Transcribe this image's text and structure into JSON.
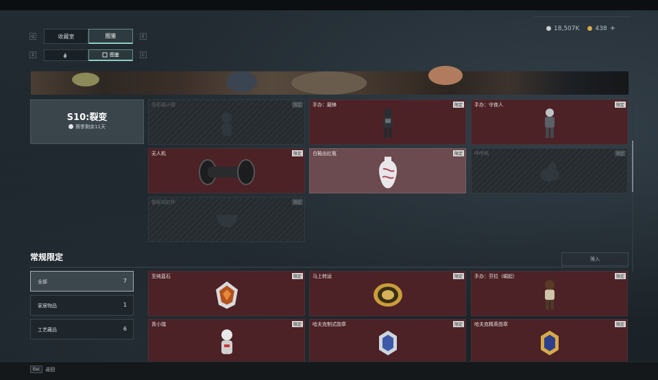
{
  "topbar": {
    "title": ""
  },
  "currency": {
    "silver_value": "18,507K",
    "gold_value": "438",
    "add_label": "+"
  },
  "tabs_primary": [
    {
      "label": "收藏室",
      "key": "Q",
      "active": false
    },
    {
      "label": "图鉴",
      "key": "E",
      "active": true
    }
  ],
  "tabs_secondary": [
    {
      "label": "",
      "key": "Z",
      "active": false
    },
    {
      "label": "图鉴",
      "key": "C",
      "active": true
    }
  ],
  "season": {
    "title": "S10:裂变",
    "subtitle": "赛季剩余11天"
  },
  "season_cards": [
    {
      "name": "炫彩福小德",
      "tag": "限定",
      "style": "dark"
    },
    {
      "name": "手办：磨锋",
      "tag": "限定",
      "style": "red"
    },
    {
      "name": "手办：守夜人",
      "tag": "限定",
      "style": "red"
    },
    {
      "name": "无人机",
      "tag": "限定",
      "style": "red"
    },
    {
      "name": "白釉出红瓶",
      "tag": "限定",
      "style": "light"
    },
    {
      "name": "呼呼鸭",
      "tag": "限定",
      "style": "dark"
    },
    {
      "name": "御窑鸡缸杯",
      "tag": "限定",
      "style": "dark"
    }
  ],
  "regular_section": {
    "title": "常规限定",
    "sort_label": "筛入"
  },
  "filters": [
    {
      "label": "全部",
      "count": "7",
      "active": true
    },
    {
      "label": "家居物品",
      "count": "1",
      "active": false
    },
    {
      "label": "工艺藏品",
      "count": "6",
      "active": false
    }
  ],
  "regular_cards": [
    {
      "name": "至纯蓝石",
      "tag": "限定"
    },
    {
      "name": "马上转运",
      "tag": "限定"
    },
    {
      "name": "手办：芬拉（崛起）",
      "tag": "限定"
    },
    {
      "name": "青小瑞",
      "tag": "限定"
    },
    {
      "name": "哈夫克制式勋章",
      "tag": "限定"
    },
    {
      "name": "哈夫克精英勋章",
      "tag": "限定"
    }
  ],
  "footer": {
    "key": "Esc",
    "label": "返回"
  },
  "colors": {
    "accent": "#8fd0c4",
    "card_red": "#4c2226",
    "card_dark": "#252b2f",
    "card_light": "#6b4b4f"
  }
}
